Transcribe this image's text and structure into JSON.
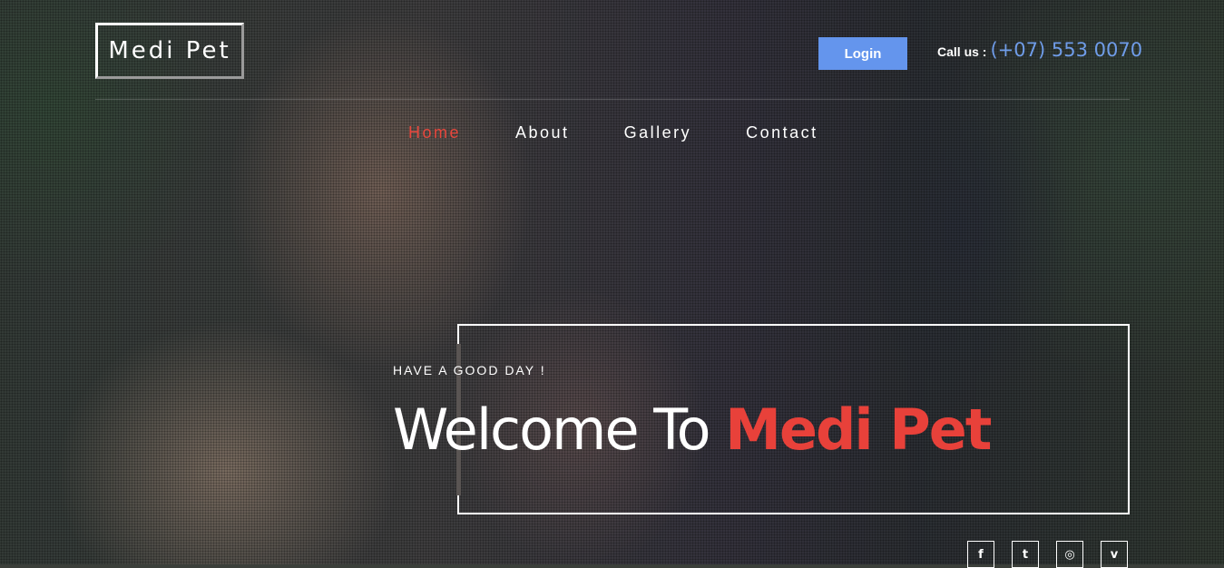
{
  "site": {
    "logo": "Medi Pet"
  },
  "header": {
    "login_label": "Login",
    "callus_label": "Call us :",
    "phone": "(+07) 553 0070"
  },
  "nav": {
    "items": [
      {
        "label": "Home",
        "active": true
      },
      {
        "label": "About",
        "active": false
      },
      {
        "label": "Gallery",
        "active": false
      },
      {
        "label": "Contact",
        "active": false
      }
    ]
  },
  "hero": {
    "tagline": "HAVE A GOOD DAY !",
    "welcome": "Welcome To ",
    "brand": "Medi Pet"
  },
  "social": {
    "icons": [
      {
        "name": "facebook-icon",
        "glyph": "f"
      },
      {
        "name": "twitter-icon",
        "glyph": "t"
      },
      {
        "name": "dribbble-icon",
        "glyph": "◎"
      },
      {
        "name": "vimeo-icon",
        "glyph": "v"
      }
    ]
  },
  "colors": {
    "accent": "#e8413a",
    "login_bg": "#6495ed",
    "phone": "#6f9ce8"
  }
}
